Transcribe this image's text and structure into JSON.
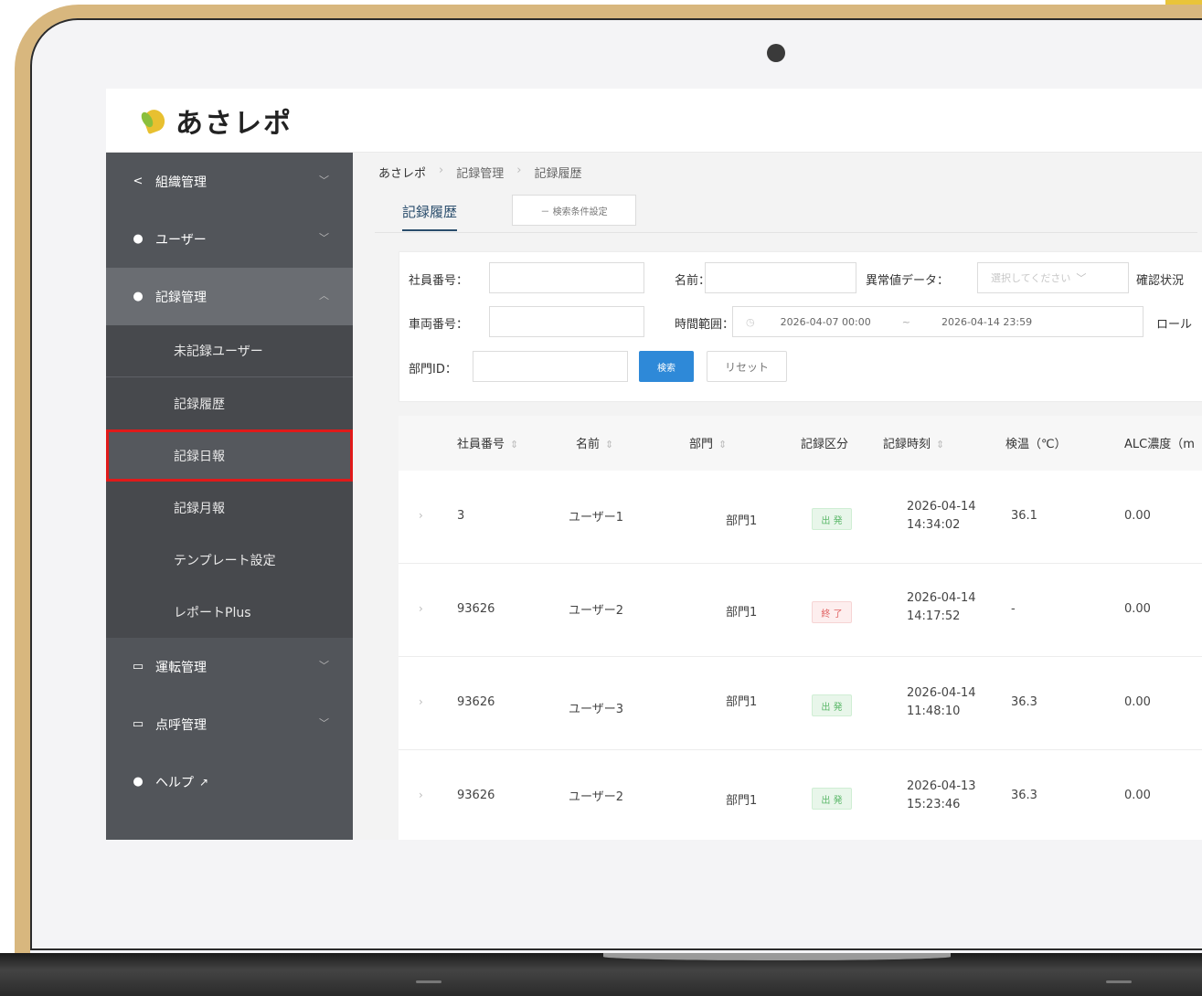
{
  "app": {
    "logo_text": "あさレポ"
  },
  "sidebar": {
    "items": [
      {
        "label": "組織管理",
        "icon": "share-icon"
      },
      {
        "label": "ユーザー",
        "icon": "user-icon"
      },
      {
        "label": "記録管理",
        "icon": "user-icon"
      }
    ],
    "sub_items": [
      {
        "label": "未記録ユーザー"
      },
      {
        "label": "記録履歴"
      },
      {
        "label": "記録日報"
      },
      {
        "label": "記録月報"
      },
      {
        "label": "テンプレート設定"
      },
      {
        "label": "レポートPlus"
      }
    ],
    "bottom_items": [
      {
        "label": "運転管理",
        "icon": "truck-icon"
      },
      {
        "label": "点呼管理",
        "icon": "camera-icon"
      },
      {
        "label": "ヘルプ",
        "icon": "help-icon"
      }
    ]
  },
  "breadcrumb": [
    "あさレポ",
    "記録管理",
    "記録履歴"
  ],
  "tabs": {
    "active": "記録履歴",
    "condition_button": "－ 検索条件設定"
  },
  "filters": {
    "employee_no_label": "社員番号：",
    "name_label": "名前：",
    "anomaly_label": "異常値データ：",
    "anomaly_placeholder": "選択してください",
    "confirm_label": "確認状況",
    "vehicle_no_label": "車両番号：",
    "time_range_label": "時間範囲：",
    "time_start": "2026-04-07 00:00",
    "time_sep": "~",
    "time_end": "2026-04-14 23:59",
    "role_label": "ロール",
    "dept_id_label": "部門ID：",
    "search_button": "検索",
    "reset_button": "リセット"
  },
  "table": {
    "headers": [
      "社員番号",
      "名前",
      "部門",
      "記録区分",
      "記録時刻",
      "検温（℃）",
      "ALC濃度（m"
    ],
    "rows": [
      {
        "employee_no": "3",
        "name": "ユーザー1",
        "dept": "部門1",
        "type": "出 発",
        "type_color": "green",
        "date": "2026-04-14",
        "time": "14:34:02",
        "temp": "36.1",
        "alc": "0.00"
      },
      {
        "employee_no": "93626",
        "name": "ユーザー2",
        "dept": "部門1",
        "type": "終 了",
        "type_color": "red",
        "date": "2026-04-14",
        "time": "14:17:52",
        "temp": "-",
        "alc": "0.00"
      },
      {
        "employee_no": "93626",
        "name": "ユーザー3",
        "dept": "部門1",
        "type": "出 発",
        "type_color": "green",
        "date": "2026-04-14",
        "time": "11:48:10",
        "temp": "36.3",
        "alc": "0.00"
      },
      {
        "employee_no": "93626",
        "name": "ユーザー2",
        "dept": "部門1",
        "type": "出 発",
        "type_color": "green",
        "date": "2026-04-13",
        "time": "15:23:46",
        "temp": "36.3",
        "alc": "0.00"
      }
    ]
  },
  "colors": {
    "sidebar": "#52555a",
    "accent_blue": "#2e89d8",
    "highlight_red": "#e01a1a",
    "laptop_gold": "#d8b77e"
  }
}
